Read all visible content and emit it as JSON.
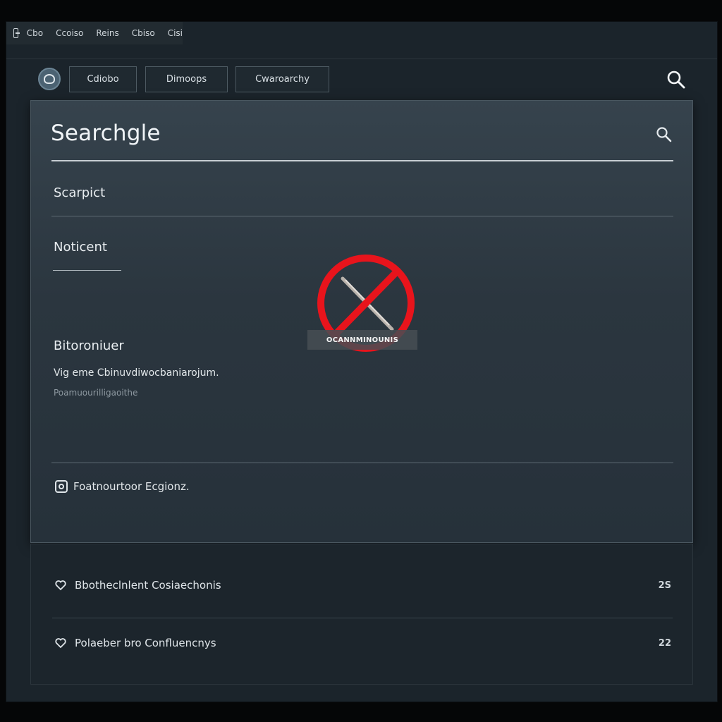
{
  "menubar": {
    "items": [
      "Cbo",
      "Ccoiso",
      "Reins",
      "Cbiso",
      "Cisi"
    ]
  },
  "nav": {
    "tabs": [
      "Cdiobo",
      "Dimoops",
      "Cwaroarchy"
    ]
  },
  "panel": {
    "title": "Searchgle",
    "section1": "Scarpict",
    "section2": "Noticent",
    "section3": "Bitoroniuer",
    "body_text": "Vig eme Cbinuvdiwocbaniarojum.",
    "body_dim": "Poamuourilligaoithe",
    "block_caption": "OCANNMINOUNIS",
    "footer_label": "Foatnourtoor Ecgionz."
  },
  "list": {
    "items": [
      {
        "label": "Bbotheclnlent Cosiaechonis",
        "count": "2S"
      },
      {
        "label": "Polaeber bro Confluencnys",
        "count": "22"
      }
    ]
  },
  "colors": {
    "background": "#1b242b",
    "panel": "#2b363f",
    "block_red": "#e8141c"
  },
  "icons": [
    "app-icon",
    "logo-icon",
    "search-icon",
    "no-entry-icon",
    "camera-icon",
    "heart-icon"
  ]
}
